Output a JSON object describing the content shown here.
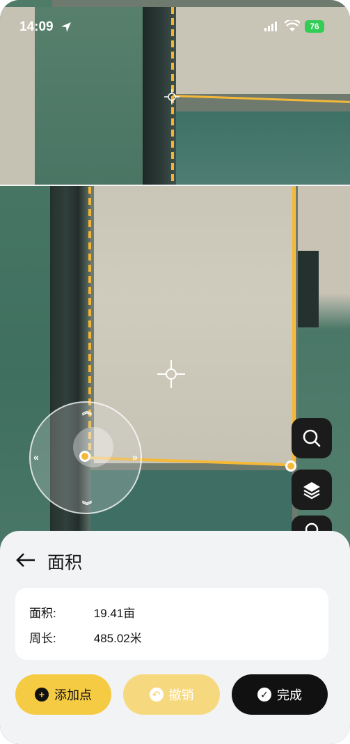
{
  "status_bar": {
    "time": "14:09",
    "battery": "76"
  },
  "map": {
    "icons": [
      "crosshair-icon",
      "joystick-icon",
      "search-icon",
      "layers-icon"
    ]
  },
  "sheet": {
    "title": "面积",
    "area_label": "面积:",
    "area_value": "19.41亩",
    "perimeter_label": "周长:",
    "perimeter_value": "485.02米"
  },
  "buttons": {
    "add_point": "添加点",
    "undo": "撤销",
    "done": "完成"
  },
  "colors": {
    "accent": "#f5cb43",
    "line": "#f5b93a",
    "dark": "#111111"
  }
}
